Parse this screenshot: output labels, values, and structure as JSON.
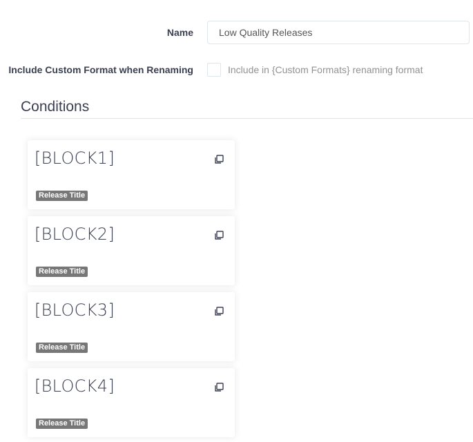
{
  "form": {
    "name_label": "Name",
    "name_value": "Low Quality Releases",
    "rename_label": "Include Custom Format when Renaming",
    "rename_checked": false,
    "rename_help": "Include in {Custom Formats} renaming format"
  },
  "conditions": {
    "title": "Conditions",
    "cards": [
      {
        "title": "[BLOCK1]",
        "tag": "Release Title",
        "icon": "clone-icon"
      },
      {
        "title": "[BLOCK2]",
        "tag": "Release Title",
        "icon": "clone-icon"
      },
      {
        "title": "[BLOCK3]",
        "tag": "Release Title",
        "icon": "clone-icon"
      },
      {
        "title": "[BLOCK4]",
        "tag": "Release Title",
        "icon": "clone-icon"
      }
    ]
  },
  "colors": {
    "text": "#3a3f51",
    "help_text": "#909293",
    "input_border": "#dde6e9",
    "badge_bg": "#777777",
    "badge_text": "#ffffff"
  }
}
